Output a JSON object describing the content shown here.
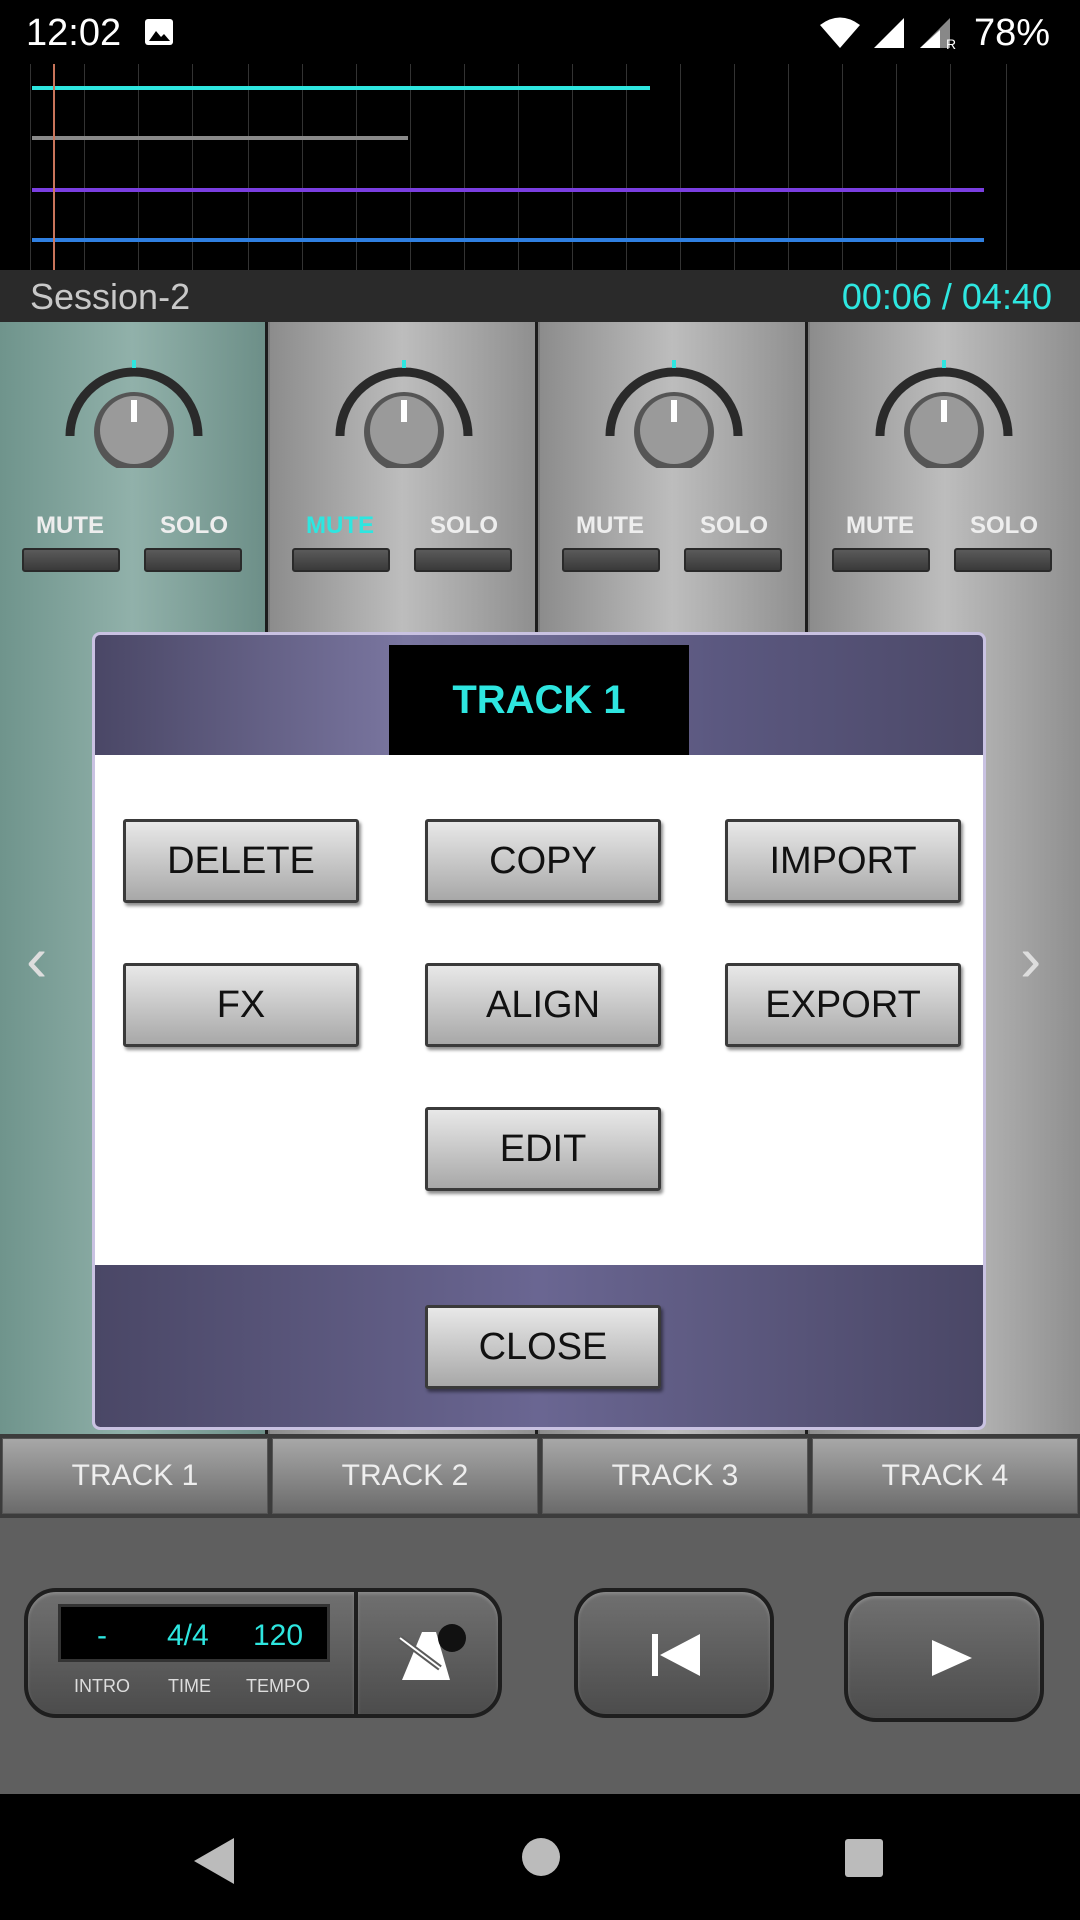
{
  "status_bar": {
    "time": "12:02",
    "battery": "78%"
  },
  "session": {
    "name": "Session-2",
    "time": "00:06 / 04:40"
  },
  "mixer": {
    "strips": [
      {
        "mute": "MUTE",
        "solo": "SOLO",
        "mute_on": false
      },
      {
        "mute": "MUTE",
        "solo": "SOLO",
        "mute_on": true
      },
      {
        "mute": "MUTE",
        "solo": "SOLO",
        "mute_on": false
      },
      {
        "mute": "MUTE",
        "solo": "SOLO",
        "mute_on": false
      }
    ],
    "prev_arrow": "‹",
    "next_arrow": "›"
  },
  "dialog": {
    "title": "TRACK 1",
    "buttons": [
      "DELETE",
      "COPY",
      "IMPORT",
      "FX",
      "ALIGN",
      "EXPORT",
      "EDIT"
    ],
    "close": "CLOSE"
  },
  "tracks": [
    "TRACK 1",
    "TRACK 2",
    "TRACK 3",
    "TRACK 4"
  ],
  "transport": {
    "intro_value": "-",
    "time_value": "4/4",
    "tempo_value": "120",
    "intro_label": "INTRO",
    "time_label": "TIME",
    "tempo_label": "TEMPO"
  },
  "colors": {
    "accent": "#2ee6e0",
    "active_strip": "#8fb0a9",
    "dialog_purple": "#6a6692"
  }
}
